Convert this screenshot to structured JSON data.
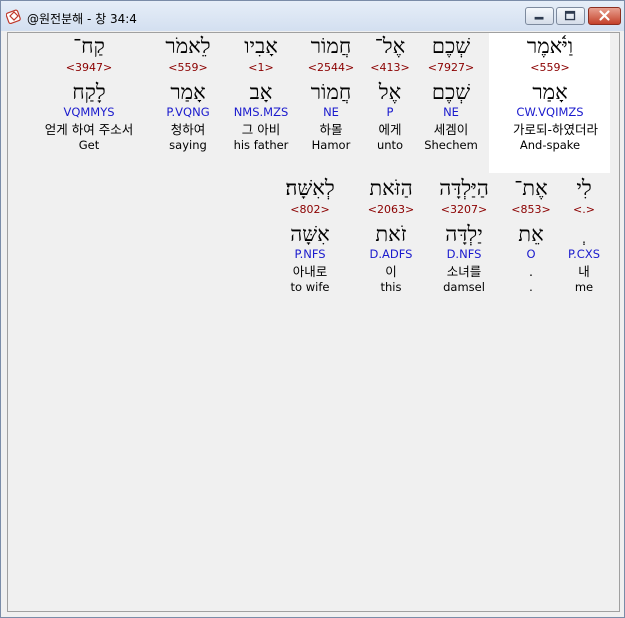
{
  "window": {
    "title": "@원전분해 - 창 34:4",
    "icon": "bible-app-icon",
    "controls": [
      "minimize",
      "maximize",
      "close"
    ]
  },
  "verse_words": {
    "row1": [
      {
        "hebrew": "וַיֹּ֫אמֶר",
        "strong": "<559>",
        "lemma": "אָמַר",
        "morph": "CW.VQIMZS",
        "korean": "가로되-하였더라",
        "english": "And-spake",
        "selected": true
      },
      {
        "hebrew": "שְׁכֶם",
        "strong": "<7927>",
        "lemma": "שְׁכֶם",
        "morph": "NE",
        "korean": "세겜이",
        "english": "Shechem"
      },
      {
        "hebrew": "אֶל־",
        "strong": "<413>",
        "lemma": "אֶל",
        "morph": "P",
        "korean": "에게",
        "english": "unto"
      },
      {
        "hebrew": "חֲמוֹר",
        "strong": "<2544>",
        "lemma": "חֲמוֹר",
        "morph": "NE",
        "korean": "하몰",
        "english": "Hamor"
      },
      {
        "hebrew": "אָבִיו",
        "strong": "<1>",
        "lemma": "אָב",
        "morph": "NMS.MZS",
        "korean": "그 아비",
        "english": "his father"
      },
      {
        "hebrew": "לֵאמֹר",
        "strong": "<559>",
        "lemma": "אָמַר",
        "morph": "P.VQNG",
        "korean": "청하여",
        "english": "saying"
      },
      {
        "hebrew": "קַח־",
        "strong": "<3947>",
        "lemma": "לָקַח",
        "morph": "VQMMYS",
        "korean": "얻게 하여 주소서",
        "english": "Get"
      }
    ],
    "row2": [
      {
        "hebrew": "לִי",
        "strong": "<.>",
        "lemma": "ְ",
        "morph": "P.CXS",
        "korean": "내",
        "english": "me"
      },
      {
        "hebrew": "אֶת־",
        "strong": "<853>",
        "lemma": "אֵת",
        "morph": "O",
        "korean": ".",
        "english": "."
      },
      {
        "hebrew": "הַיַּלְדָּה",
        "strong": "<3207>",
        "lemma": "יַלְדָּה",
        "morph": "D.NFS",
        "korean": "소녀를",
        "english": "damsel"
      },
      {
        "hebrew": "הַזֹּאת",
        "strong": "<2063>",
        "lemma": "זֹאת",
        "morph": "D.ADFS",
        "korean": "이",
        "english": "this"
      },
      {
        "hebrew": "לְאִשָּׁה׃",
        "strong": "<802>",
        "lemma": "אִשָּׁה",
        "morph": "P.NFS",
        "korean": "아내로",
        "english": "to wife"
      }
    ]
  },
  "colors": {
    "strong": "#8b0000",
    "morph": "#1a1acd",
    "text": "#000000",
    "background": "#f0f0f0",
    "selected_background": "#ffffff"
  }
}
